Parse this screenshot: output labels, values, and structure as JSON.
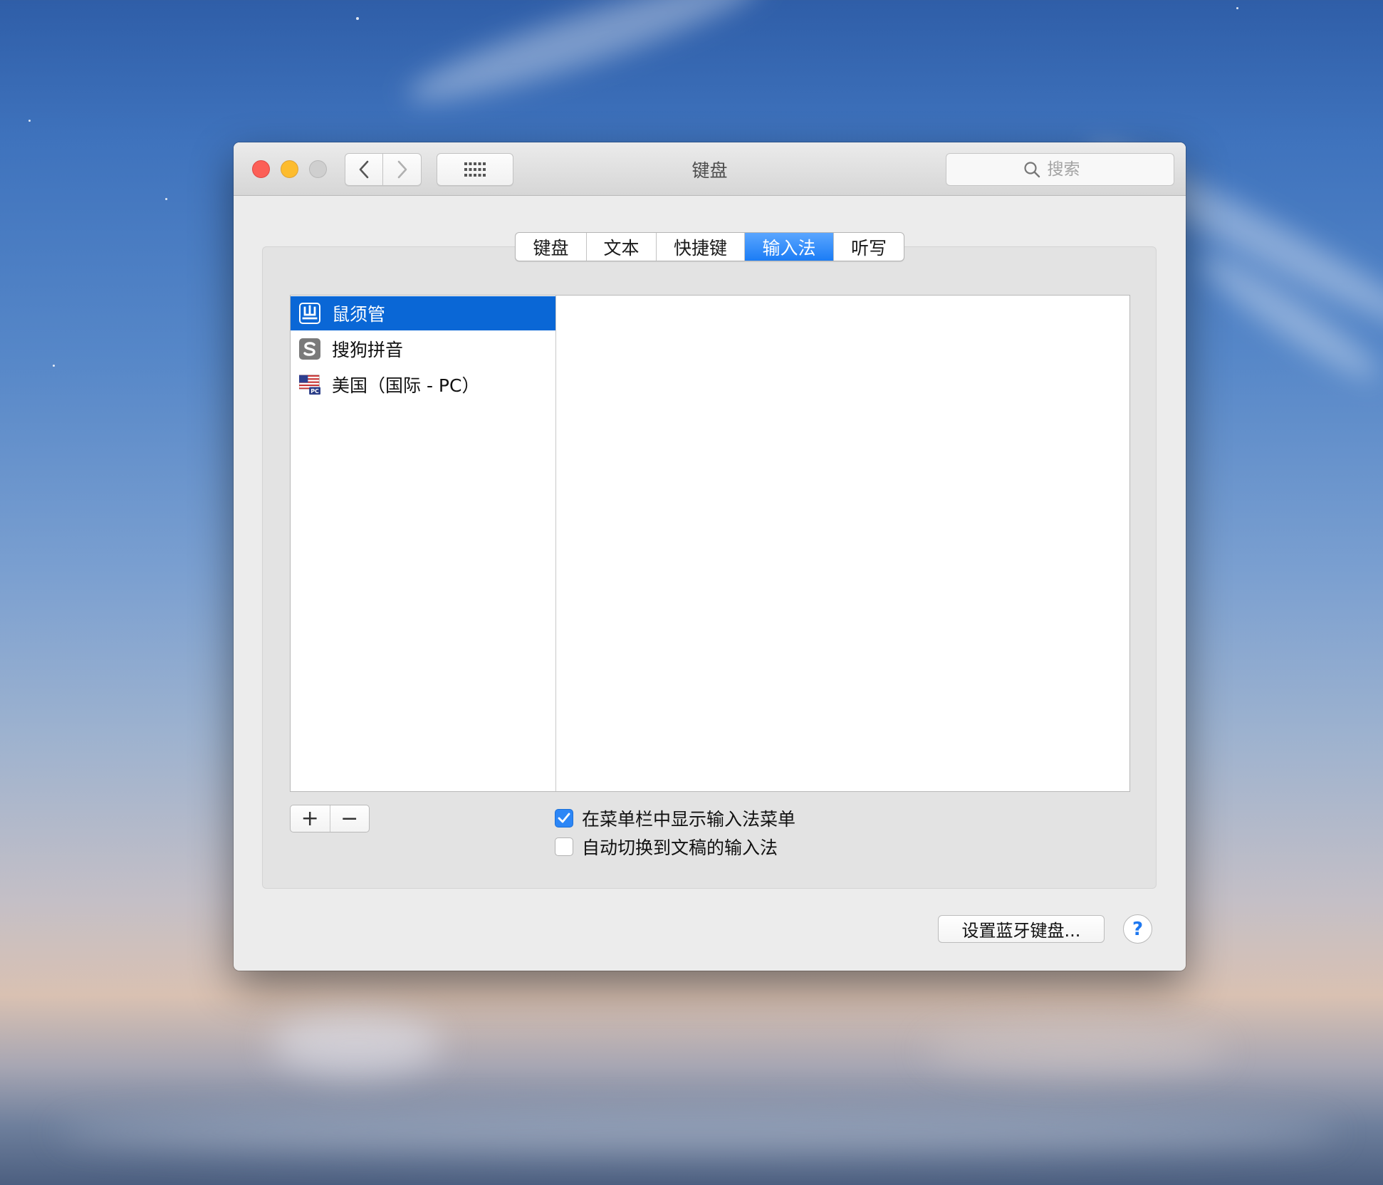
{
  "window": {
    "title": "键盘",
    "search_placeholder": "搜索"
  },
  "tabs": [
    {
      "label": "键盘",
      "active": false
    },
    {
      "label": "文本",
      "active": false
    },
    {
      "label": "快捷键",
      "active": false
    },
    {
      "label": "输入法",
      "active": true
    },
    {
      "label": "听写",
      "active": false
    }
  ],
  "input_sources": [
    {
      "label": "鼠须管",
      "icon": "shuxu-icon",
      "selected": true
    },
    {
      "label": "搜狗拼音",
      "icon": "sogou-icon",
      "selected": false
    },
    {
      "label": "美国（国际 - PC）",
      "icon": "us-flag-icon",
      "selected": false
    }
  ],
  "list_controls": {
    "add": "+",
    "remove": "−"
  },
  "options": {
    "show_menu": {
      "label": "在菜单栏中显示输入法菜单",
      "checked": true
    },
    "auto_switch": {
      "label": "自动切换到文稿的输入法",
      "checked": false
    }
  },
  "footer": {
    "bluetooth_button": "设置蓝牙键盘...",
    "help_button": "?"
  },
  "colors": {
    "accent": "#0a67d6",
    "tab_active": "#1b7cf5",
    "close": "#fc5f57",
    "minimize": "#fdbc2e"
  }
}
